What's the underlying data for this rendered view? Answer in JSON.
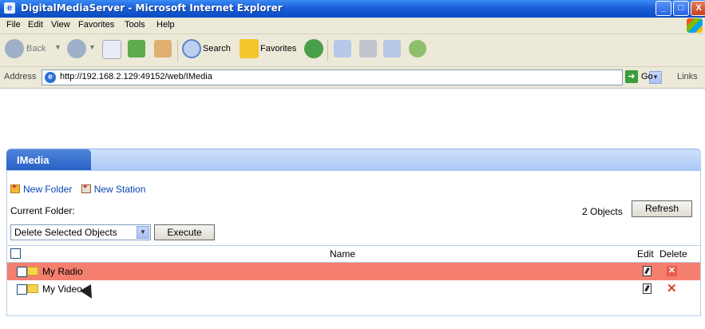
{
  "window": {
    "title": "DigitalMediaServer - Microsoft Internet Explorer",
    "min_glyph": "_",
    "max_glyph": "□",
    "close_glyph": "X"
  },
  "menu": [
    "File",
    "Edit",
    "View",
    "Favorites",
    "Tools",
    "Help"
  ],
  "toolbar": {
    "back_label": "Back",
    "search_label": "Search",
    "favorites_label": "Favorites"
  },
  "address": {
    "label": "Address",
    "url": "http://192.168.2.129:49152/web/IMedia",
    "go_label": "Go",
    "links_label": "Links"
  },
  "page": {
    "tab_label": "IMedia",
    "new_folder_label": "New Folder",
    "new_station_label": "New Station",
    "current_folder_label": "Current Folder:",
    "object_count": "2 Objects",
    "refresh_label": "Refresh",
    "bulk_action_value": "Delete Selected Objects",
    "execute_label": "Execute",
    "columns": {
      "name": "Name",
      "edit": "Edit",
      "delete": "Delete"
    },
    "rows": [
      {
        "name": "My Radio",
        "selected": true
      },
      {
        "name": "My Video",
        "selected": false
      }
    ]
  }
}
